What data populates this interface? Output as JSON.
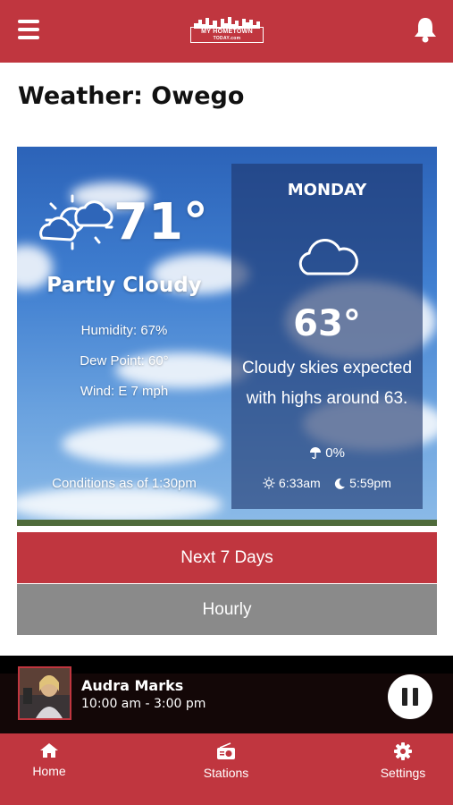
{
  "header": {
    "logo_line1": "MY HOMETOWN",
    "logo_line2": "TODAY.com",
    "brand_color": "#c0363f"
  },
  "page": {
    "title": "Weather: Owego"
  },
  "current": {
    "icon": "partly-cloudy-icon",
    "temperature": "71°",
    "condition": "Partly Cloudy",
    "humidity": "Humidity: 67%",
    "dew_point": "Dew Point: 60°",
    "wind": "Wind: E 7 mph",
    "conditions_as_of": "Conditions as of 1:30pm"
  },
  "forecast": {
    "day": "MONDAY",
    "icon": "cloud-icon",
    "temperature": "63°",
    "description_line1": "Cloudy skies expected",
    "description_line2": "with highs around 63.",
    "precip": "0%",
    "sunrise": "6:33am",
    "sunset": "5:59pm"
  },
  "buttons": {
    "next_7_days": "Next 7 Days",
    "hourly": "Hourly"
  },
  "player": {
    "host_name": "Audra Marks",
    "time_slot": "10:00 am - 3:00 pm",
    "state": "playing"
  },
  "bottom_nav": {
    "items": [
      {
        "label": "Home",
        "icon": "home-icon"
      },
      {
        "label": "Stations",
        "icon": "radio-icon"
      },
      {
        "label": "Settings",
        "icon": "gear-icon"
      }
    ]
  }
}
